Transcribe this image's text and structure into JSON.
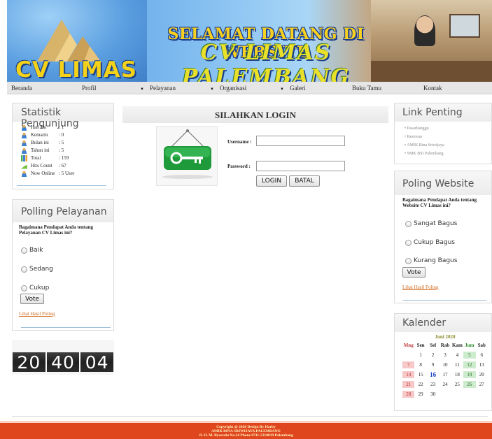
{
  "header": {
    "logo_text": "CV LIMAS",
    "welcome": "SELAMAT DATANG DI WEBSITE",
    "company": "CV LIMAS PALEMBANG"
  },
  "nav": {
    "items": [
      {
        "label": "Beranda",
        "dropdown": false
      },
      {
        "label": "Profil",
        "dropdown": false
      },
      {
        "label": "Pelayanan",
        "dropdown": true
      },
      {
        "label": "Organisasi",
        "dropdown": true
      },
      {
        "label": "Galeri",
        "dropdown": true
      },
      {
        "label": "Buku Tamu",
        "dropdown": false
      },
      {
        "label": "Kontak",
        "dropdown": false
      }
    ]
  },
  "stats": {
    "title": "Statistik Pengunjung",
    "rows": [
      {
        "label": "Hari Ini",
        "value": ": 1",
        "icon": "user-icon"
      },
      {
        "label": "Kemarin",
        "value": ": 0",
        "icon": "user-icon"
      },
      {
        "label": "Bulan ini",
        "value": ": 5",
        "icon": "user-icon"
      },
      {
        "label": "Tahun ini",
        "value": ": 5",
        "icon": "user-icon"
      },
      {
        "label": "Total",
        "value": ": 159",
        "icon": "bar-icon"
      },
      {
        "label": "Hits Count",
        "value": ": 67",
        "icon": "chart-icon"
      },
      {
        "label": "Now Online",
        "value": ": 5 User",
        "icon": "user-icon"
      }
    ]
  },
  "polling_left": {
    "title": "Polling Pelayanan",
    "question": "Bagaimana Pendapat Anda tentang Pelayanan CV Limas ini?",
    "options": [
      "Baik",
      "Sedang",
      "Cukup"
    ],
    "vote_label": "Vote",
    "results_link": "Lihat Hasil Poling"
  },
  "clock": {
    "hh": "20",
    "mm": "40",
    "ss": "04"
  },
  "login": {
    "title": "SILAHKAN LOGIN",
    "username_label": "Username  :",
    "password_label": "Password  :",
    "username_value": "",
    "password_value": "",
    "login_button": "LOGIN",
    "cancel_button": "BATAL"
  },
  "links": {
    "title": "Link Penting",
    "items": [
      "Pasarlianggu",
      "Restoran",
      "AMIK Bina Sriwijaya",
      "SMK BSI Palembang"
    ]
  },
  "polling_right": {
    "title": "Poling Website",
    "question": "Bagaimana Pendapat Anda tentang Website CV Limas ini?",
    "options": [
      "Sangat Bagus",
      "Cukup Bagus",
      "Kurang Bagus"
    ],
    "vote_label": "Vote",
    "results_link": "Lihat Hasil Poling"
  },
  "calendar": {
    "title": "Kalender",
    "month": "Juni 2020",
    "days": [
      "Mng",
      "Sen",
      "Sel",
      "Rab",
      "Kam",
      "Jum",
      "Sab"
    ],
    "weeks": [
      [
        "",
        "1",
        "2",
        "3",
        "4",
        "5",
        "6"
      ],
      [
        "7",
        "8",
        "9",
        "10",
        "11",
        "12",
        "13"
      ],
      [
        "14",
        "15",
        "16",
        "17",
        "18",
        "19",
        "20"
      ],
      [
        "21",
        "22",
        "23",
        "24",
        "25",
        "26",
        "27"
      ],
      [
        "28",
        "29",
        "30",
        "",
        "",
        "",
        ""
      ]
    ],
    "today": "16"
  },
  "footer": {
    "line1": "Copyright @ 2020 Design By Harby",
    "line2": "AMIK BINA SRIWIJAYA PALEMBANG",
    "line3": "Jl. H. M. Ryacudu No.24 Phone 0711-5210019 Palembang"
  },
  "colors": {
    "footer": "#e0461e",
    "accent": "#d2691e",
    "nav_bg": "#e6e6e6"
  }
}
